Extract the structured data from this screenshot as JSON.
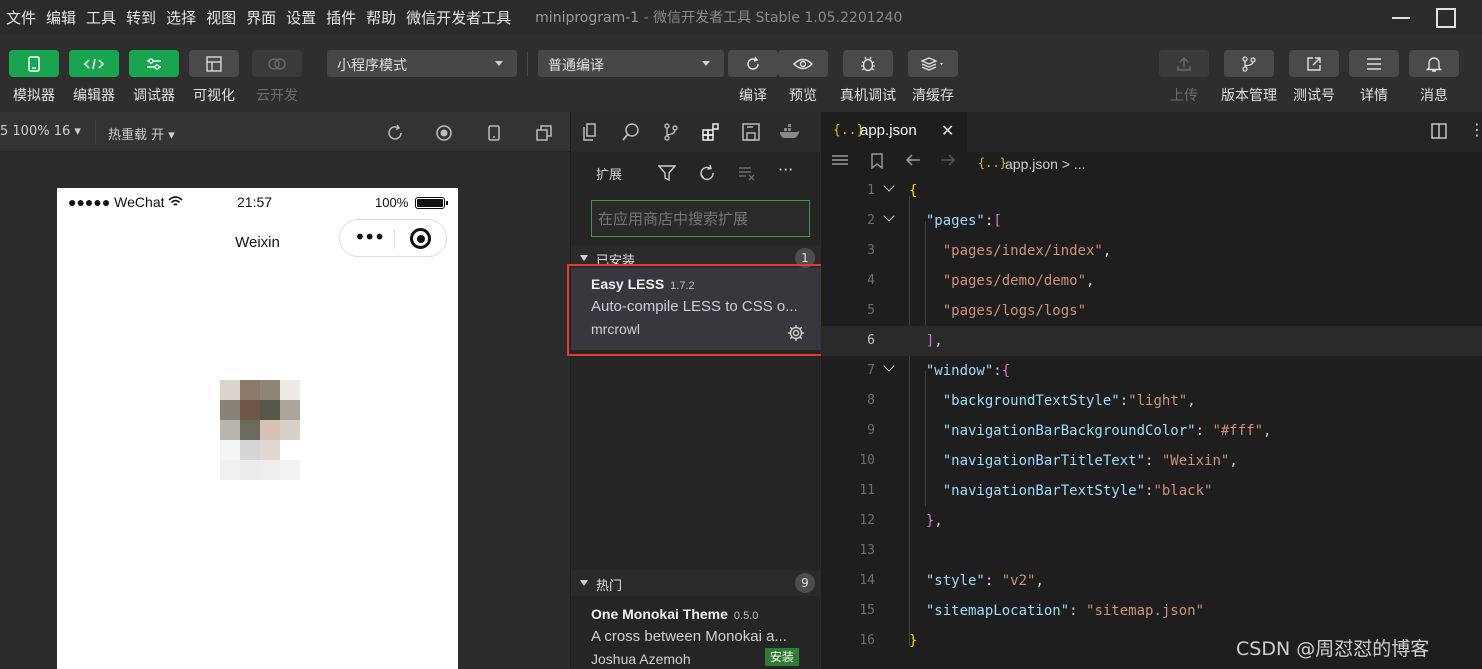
{
  "menu": {
    "items": [
      "文件",
      "编辑",
      "工具",
      "转到",
      "选择",
      "视图",
      "界面",
      "设置",
      "插件",
      "帮助",
      "微信开发者工具"
    ],
    "app_title": "miniprogram-1",
    "app_version": "- 微信开发者工具 Stable 1.05.2201240"
  },
  "toolbar": {
    "simulator": "模拟器",
    "editor": "编辑器",
    "debugger": "调试器",
    "visual": "可视化",
    "cloud": "云开发",
    "mode_select": "小程序模式",
    "compile_select": "普通编译",
    "compile": "编译",
    "preview": "预览",
    "remote_debug": "真机调试",
    "clear_cache": "清缓存",
    "upload": "上传",
    "version": "版本管理",
    "test_id": "测试号",
    "details": "详情",
    "messages": "消息"
  },
  "simulator": {
    "zoom": "5 100% 16 ▾",
    "hot_reload": "热重载 开 ▾",
    "status_left": "●●●●● WeChat",
    "time": "21:57",
    "battery": "100%",
    "nav_title": "Weixin"
  },
  "extensions": {
    "title": "扩展",
    "search_placeholder": "在应用商店中搜索扩展",
    "installed_label": "已安装",
    "installed_count": "1",
    "installed": [
      {
        "name": "Easy LESS",
        "version": "1.7.2",
        "desc": "Auto-compile LESS to CSS o...",
        "author": "mrcrowl"
      }
    ],
    "popular_label": "热门",
    "popular_count": "9",
    "popular": [
      {
        "name": "One Monokai Theme",
        "version": "0.5.0",
        "desc": "A cross between Monokai a...",
        "author": "Joshua Azemoh",
        "action": "安装"
      }
    ]
  },
  "editor": {
    "tab": "app.json",
    "tab_icon": "{..}",
    "breadcrumb": "app.json",
    "breadcrumb_more": "> ...",
    "current_line": 6
  },
  "watermark": "CSDN @周怼怼的博客",
  "colors": {
    "accent_green": "#19a54f",
    "highlight_red": "#e53935",
    "json_key": "#9cdcfe",
    "json_string": "#ce9178"
  }
}
